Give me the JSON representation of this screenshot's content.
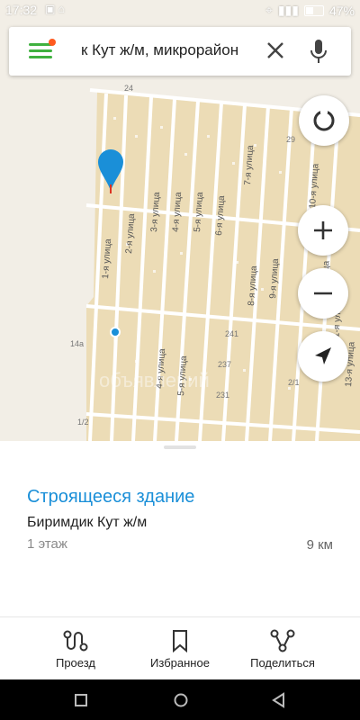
{
  "status": {
    "time": "17:32",
    "battery": "47%",
    "icons_left": "▣ ⌂"
  },
  "search": {
    "query": "к Кут ж/м, микрорайон"
  },
  "map": {
    "streets": [
      "1-я улица",
      "2-я улица",
      "3-я улица",
      "4-я улица",
      "5-я улица",
      "6-я улица",
      "7-я улица",
      "8-я улица",
      "9-я улица",
      "10-я улица",
      "11-я улица",
      "12-я улица",
      "13-я улица",
      "4-я улица",
      "5-я улица"
    ],
    "numbers": [
      "24",
      "29",
      "14а",
      "241",
      "237",
      "231",
      "2/1",
      "1/2"
    ],
    "watermark": "объявлений"
  },
  "place": {
    "title": "Строящееся здание",
    "subtitle": "Биримдик Кут ж/м",
    "floors": "1 этаж",
    "distance": "9 км"
  },
  "actions": [
    {
      "label": "Проезд",
      "icon": "route-icon"
    },
    {
      "label": "Избранное",
      "icon": "bookmark-icon"
    },
    {
      "label": "Поделиться",
      "icon": "share-icon"
    }
  ],
  "colors": {
    "accent": "#1a8fd8",
    "map_block": "#ecdcb6",
    "map_bg": "#f2eee6",
    "menu_green": "#3fb13f"
  }
}
